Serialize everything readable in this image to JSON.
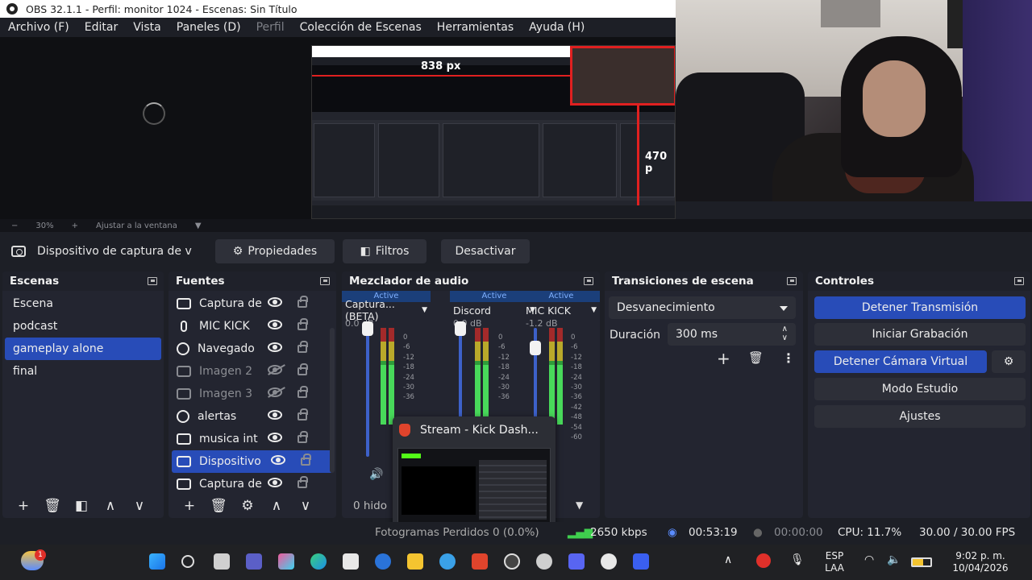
{
  "window": {
    "title": "OBS 32.1.1 - Perfil: monitor 1024 - Escenas: Sin Título"
  },
  "menu": [
    "Archivo (F)",
    "Editar",
    "Vista",
    "Paneles (D)",
    "Perfil",
    "Colección de Escenas",
    "Herramientas",
    "Ayuda (H)"
  ],
  "preview": {
    "nested_label_width": "838 px",
    "nested_label_height": "470 p"
  },
  "zoom": {
    "minus": "−",
    "level": "30%",
    "plus": "+",
    "fit_label": "Ajustar a la ventana"
  },
  "source_toolbar": {
    "source_name": "Dispositivo de captura de v",
    "properties": "Propiedades",
    "filters": "Filtros",
    "deactivate": "Desactivar"
  },
  "scenes": {
    "title": "Escenas",
    "items": [
      "Escena",
      "podcast",
      "gameplay alone",
      "final"
    ],
    "selected_index": 2
  },
  "sources": {
    "title": "Fuentes",
    "items": [
      {
        "label": "Captura de",
        "icon": "monitor-capture-icon",
        "visible": true
      },
      {
        "label": "MIC KICK",
        "icon": "microphone-icon",
        "visible": true
      },
      {
        "label": "Navegado",
        "icon": "browser-icon",
        "visible": true
      },
      {
        "label": "Imagen 2",
        "icon": "image-icon",
        "visible": false
      },
      {
        "label": "Imagen 3",
        "icon": "image-icon",
        "visible": false
      },
      {
        "label": "alertas",
        "icon": "browser-icon",
        "visible": true
      },
      {
        "label": "musica int",
        "icon": "audio-capture-icon",
        "visible": true
      },
      {
        "label": "Dispositivo",
        "icon": "camera-icon",
        "visible": true
      },
      {
        "label": "Captura de",
        "icon": "display-capture-icon",
        "visible": true
      }
    ],
    "selected_index": 7
  },
  "mixer": {
    "title": "Mezclador de audio",
    "channels": [
      {
        "active": "Active",
        "name": "Captura... (BETA)",
        "db": "0.0 dB",
        "level": 0.62
      },
      {
        "active": "Active",
        "name": "Discord",
        "db": "0.0 dB",
        "level": 0.55
      },
      {
        "active": "Active",
        "name": "MIC KICK",
        "db": "-1.2 dB",
        "level": 0.58
      }
    ],
    "scale": [
      "0",
      "-6",
      "-12",
      "-18",
      "-24",
      "-30",
      "-36",
      "-42",
      "-48",
      "-54",
      "-60"
    ],
    "hidden_text": "0 hido",
    "popup_title": "Stream - Kick Dash..."
  },
  "transitions": {
    "title": "Transiciones de escena",
    "type": "Desvanecimiento",
    "duration_label": "Duración",
    "duration_value": "300 ms"
  },
  "controls": {
    "title": "Controles",
    "stop_stream": "Detener Transmisión",
    "start_recording": "Iniciar Grabación",
    "stop_virtualcam": "Detener Cámara Virtual",
    "studio_mode": "Modo Estudio",
    "settings": "Ajustes"
  },
  "status": {
    "dropped": "Fotogramas Perdidos 0 (0.0%)",
    "bitrate": "2650 kbps",
    "stream_time": "00:53:19",
    "rec_time": "00:00:00",
    "cpu": "CPU: 11.7%",
    "fps": "30.00 / 30.00 FPS"
  },
  "taskbar": {
    "weather_badge": "1",
    "lang_top": "ESP",
    "lang_bottom": "LAA",
    "time": "9:02 p. m.",
    "date": "10/04/2026"
  },
  "colors": {
    "accent": "#284cb8",
    "background": "#1d1f26",
    "dock": "#232530"
  }
}
